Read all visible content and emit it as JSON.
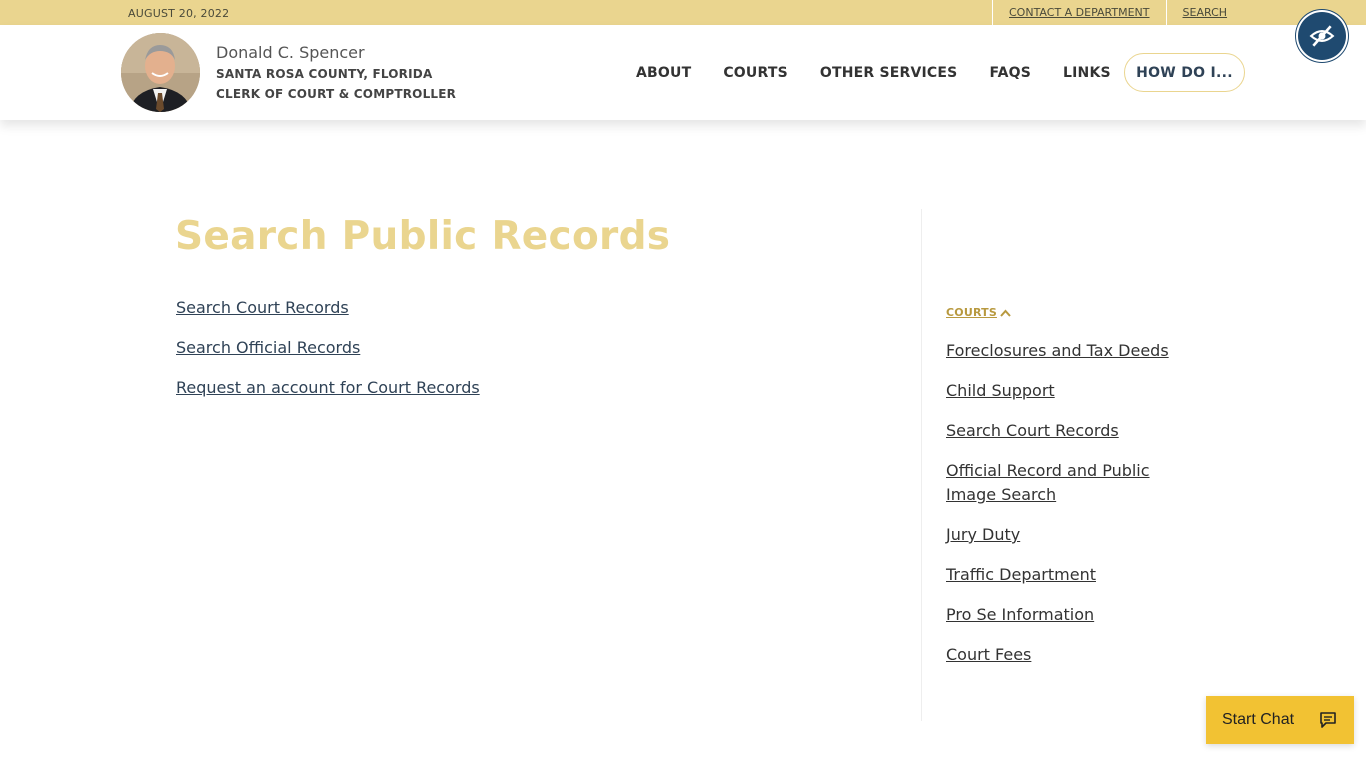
{
  "topbar": {
    "date": "AUGUST 20, 2022",
    "links": [
      "CONTACT A DEPARTMENT",
      "SEARCH"
    ]
  },
  "header": {
    "name": "Donald C. Spencer",
    "county": "SANTA ROSA COUNTY, FLORIDA",
    "title": "CLERK OF COURT & COMPTROLLER",
    "nav": [
      "ABOUT",
      "COURTS",
      "OTHER SERVICES",
      "FAQS",
      "LINKS"
    ],
    "cta": "HOW DO I..."
  },
  "main": {
    "title": "Search Public Records",
    "links": [
      "Search Court Records",
      "Search Official Records",
      "Request an account for Court Records"
    ]
  },
  "sidebar": {
    "heading": "COURTS",
    "links": [
      "Foreclosures and Tax Deeds",
      "Child Support",
      "Search Court Records",
      "Official Record and Public Image Search",
      "Jury Duty",
      "Traffic Department",
      "Pro Se Information",
      "Court Fees"
    ]
  },
  "chat": {
    "label": "Start Chat"
  },
  "colors": {
    "gold": "#ead58f",
    "navy": "#2f4256",
    "chat": "#f2c233",
    "accessibility": "#1f4a70"
  },
  "icons": {
    "accessibility": "eye-slash-icon",
    "chat": "chat-bubble-icon",
    "chevron": "chevron-up-icon"
  }
}
